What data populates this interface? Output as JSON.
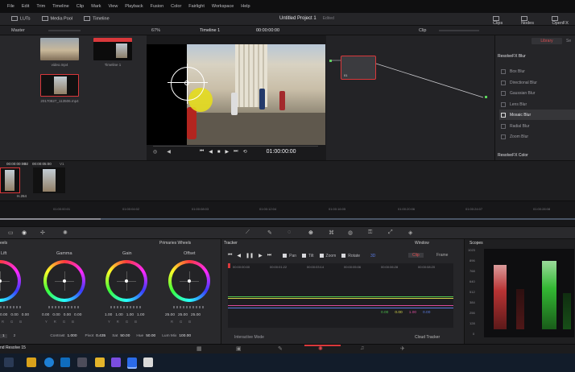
{
  "window": {
    "title": "Untitled Project 1",
    "status": "Edited"
  },
  "menu": [
    "File",
    "Edit",
    "Trim",
    "Timeline",
    "Clip",
    "Mark",
    "View",
    "Playback",
    "Fusion",
    "Color",
    "Fairlight",
    "Workspace",
    "Help"
  ],
  "toolbar": {
    "lut_label": "LUTs",
    "media_pool_label": "Media Pool",
    "timeline_label": "Timeline",
    "clips_label": "Clips",
    "nodes_label": "Nodes",
    "fx_label": "OpenFX"
  },
  "subbar": {
    "master_label": "Master",
    "zoom": "67%",
    "timeline_name": "Timeline 1",
    "timecode": "00:00:00:00",
    "clip_label": "Clip"
  },
  "media": [
    {
      "name": "video.mp4"
    },
    {
      "name": "Timeline 1"
    },
    {
      "name": "20170827_113506.mp4"
    }
  ],
  "viewer": {
    "timecode": "01:00:00:00"
  },
  "node": {
    "number": "01"
  },
  "library": {
    "tab_library": "Library",
    "tab_settings": "Se",
    "section1": "ResolveFX Blur",
    "items": [
      "Box Blur",
      "Directional Blur",
      "Gaussian Blur",
      "Lens Blur",
      "Mosaic Blur",
      "Radial Blur",
      "Zoom Blur"
    ],
    "selected_index": 4,
    "section2": "ResolveFX Color"
  },
  "clips": {
    "clip1_label": "01",
    "clip1_tc": "00:00:00:00",
    "clip1_track": "V1",
    "clip2_label": "02",
    "clip2_tc": "00:00:05:00",
    "clip2_track": "V1",
    "codec": "H.264"
  },
  "mini_timeline": {
    "ticks": [
      "01:00:00:01",
      "01:00:04:02",
      "01:00:08:03",
      "01:00:12:04",
      "01:00:16:05",
      "01:00:20:06",
      "01:00:24:07",
      "01:00:28:08"
    ]
  },
  "wheels": {
    "panel_label": "eels",
    "mode_label": "Primaries Wheels",
    "items": [
      {
        "name": "Lift",
        "values": [
          "0.00",
          "0.00",
          "0.00"
        ],
        "sub": [
          "R",
          "G",
          "B"
        ]
      },
      {
        "name": "Gamma",
        "values": [
          "0.00",
          "0.00",
          "0.00",
          "0.00"
        ],
        "sub": [
          "Y",
          "R",
          "G",
          "B"
        ]
      },
      {
        "name": "Gain",
        "values": [
          "1.00",
          "1.00",
          "1.00",
          "1.00"
        ],
        "sub": [
          "Y",
          "R",
          "G",
          "B"
        ]
      },
      {
        "name": "Offset",
        "values": [
          "25.00",
          "25.00",
          "25.00"
        ],
        "sub": [
          "R",
          "G",
          "B"
        ]
      }
    ],
    "footer": {
      "page_1": "1",
      "page_2": "2",
      "contrast_label": "Contrast",
      "contrast": "1.000",
      "pivot_label": "Pivot",
      "pivot": "0.435",
      "sat_label": "Sat",
      "sat": "50.00",
      "hue_label": "Hue",
      "hue": "50.00",
      "lummix_label": "Lum Mix",
      "lummix": "100.00"
    }
  },
  "tracker": {
    "title": "Tracker",
    "window_label": "Window",
    "checks": [
      "Pan",
      "Tilt",
      "Zoom",
      "Rotate"
    ],
    "three_d": "3D",
    "clip_btn": "Clip",
    "frame_btn": "Frame",
    "ruler": [
      "00:00:00:00",
      "00:00:01:22",
      "00:00:03:14",
      "00:00:05:06",
      "00:00:06:28",
      "00:00:08:20"
    ],
    "readouts": [
      "0.00",
      "0.00",
      "1.00",
      "0.00"
    ],
    "interactive_mode": "Interactive Mode",
    "cloud_tracker": "Cloud Tracker"
  },
  "scopes": {
    "title": "Scopes",
    "scale": [
      "1023",
      "896",
      "768",
      "640",
      "512",
      "384",
      "256",
      "128",
      "0"
    ]
  },
  "taskbar": {
    "app_label": "nd Resolve 15"
  },
  "colors": {
    "accent": "#d9383b",
    "background": "#1b1b1d"
  }
}
